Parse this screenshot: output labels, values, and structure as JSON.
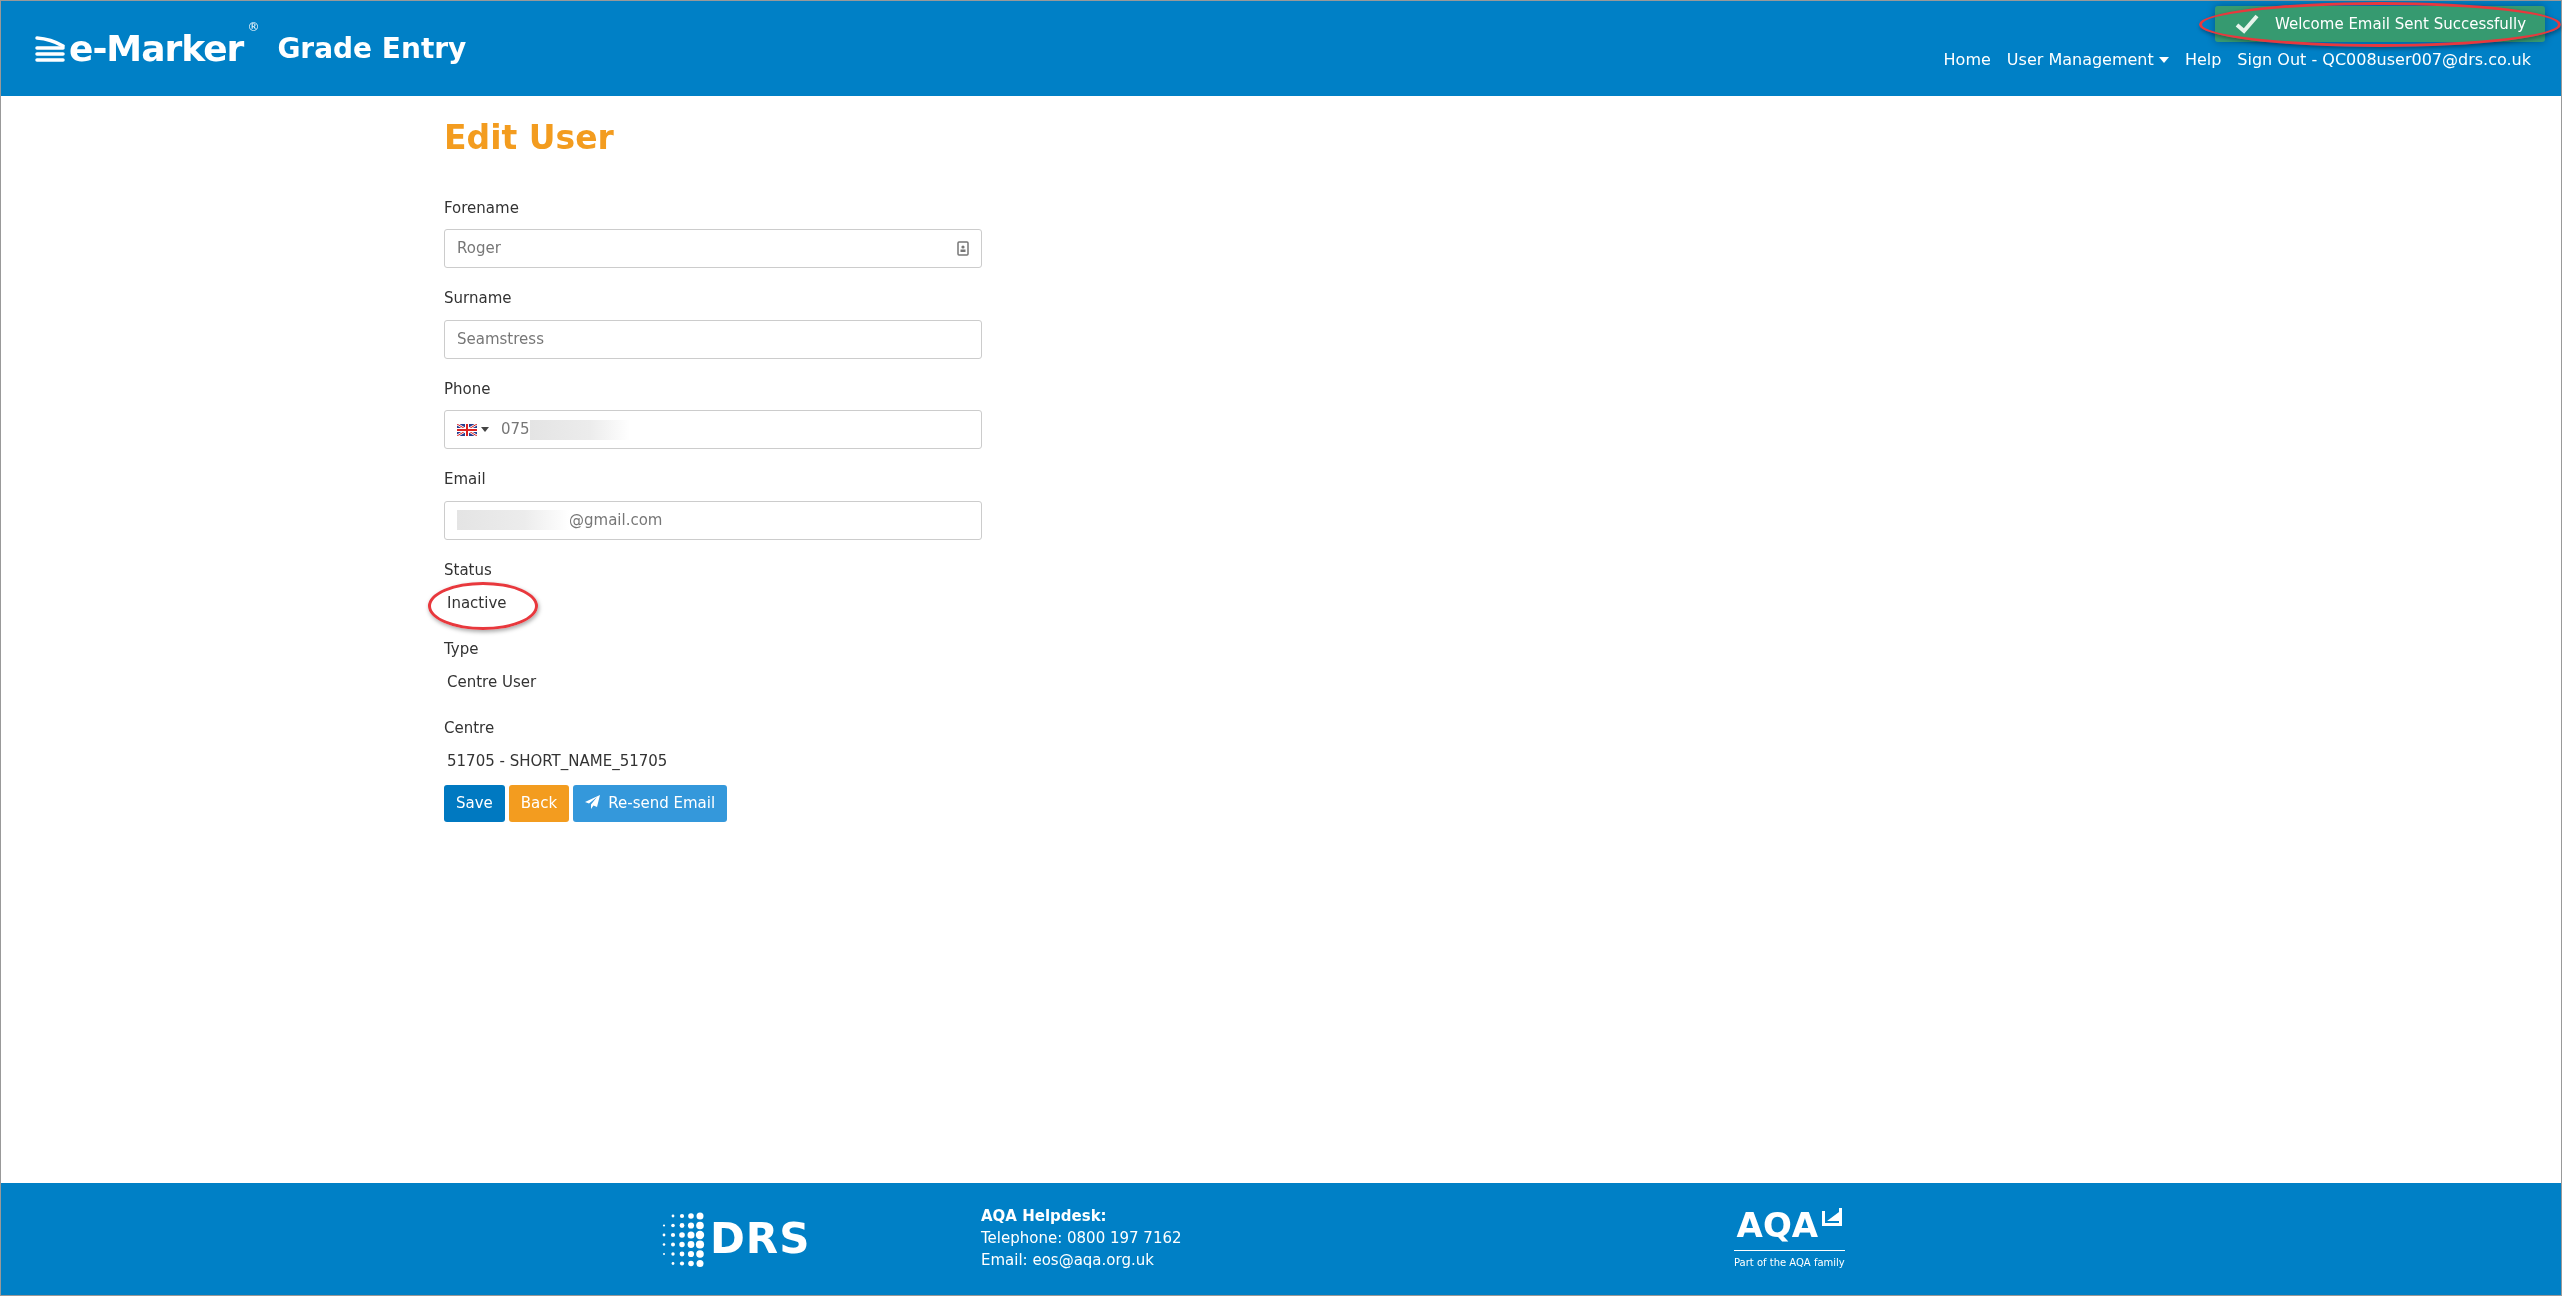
{
  "header": {
    "logo_text": "e-Marker",
    "logo_mark": "®",
    "title": "Grade Entry",
    "nav": [
      {
        "label": "Home",
        "kind": "link"
      },
      {
        "label": "User Management",
        "kind": "dropdown"
      },
      {
        "label": "Help",
        "kind": "link"
      },
      {
        "label": "Sign Out - QC008user007@drs.co.uk",
        "kind": "link"
      }
    ]
  },
  "toast": {
    "message": "Welcome Email Sent Successfully",
    "highlighted": true
  },
  "page_title": "Edit User",
  "fields": [
    {
      "label": "Forename",
      "kind": "input",
      "value": "Roger",
      "contact_icon": true
    },
    {
      "label": "Surname",
      "kind": "input",
      "value": "Seamstress"
    },
    {
      "label": "Phone",
      "kind": "phone",
      "value": "075",
      "blur_after": true
    },
    {
      "label": "Email",
      "kind": "input",
      "value": "@gmail.com",
      "blur_before": true
    },
    {
      "label": "Status",
      "kind": "static",
      "value": "Inactive",
      "highlighted": true
    },
    {
      "label": "Type",
      "kind": "static",
      "value": "Centre User"
    },
    {
      "label": "Centre",
      "kind": "static",
      "value": "51705 - SHORT_NAME_51705"
    }
  ],
  "buttons": [
    {
      "label": "Save",
      "kind": "save"
    },
    {
      "label": "Back",
      "kind": "back"
    },
    {
      "label": "Re-send Email",
      "kind": "resend"
    }
  ],
  "footer": {
    "drs_text": "DRS",
    "helpdesk_title": "AQA Helpdesk:",
    "telephone": "Telephone: 0800 197 7162",
    "email": "Email: eos@aqa.org.uk",
    "aqa_text": "AQA",
    "aqa_tagline": "Part of the AQA family"
  }
}
